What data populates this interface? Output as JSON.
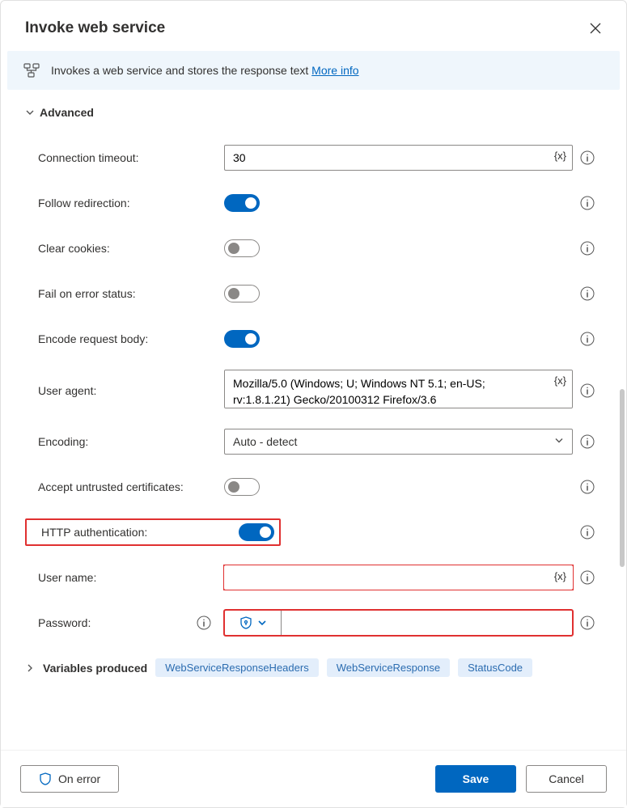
{
  "header": {
    "title": "Invoke web service"
  },
  "banner": {
    "text": "Invokes a web service and stores the response text",
    "moreLabel": "More info"
  },
  "sections": {
    "advanced": "Advanced",
    "variablesProduced": "Variables produced"
  },
  "fields": {
    "connectionTimeout": {
      "label": "Connection timeout:",
      "value": "30"
    },
    "followRedirection": {
      "label": "Follow redirection:",
      "on": true
    },
    "clearCookies": {
      "label": "Clear cookies:",
      "on": false
    },
    "failOnError": {
      "label": "Fail on error status:",
      "on": false
    },
    "encodeBody": {
      "label": "Encode request body:",
      "on": true
    },
    "userAgent": {
      "label": "User agent:",
      "value": "Mozilla/5.0 (Windows; U; Windows NT 5.1; en-US; rv:1.8.1.21) Gecko/20100312 Firefox/3.6"
    },
    "encoding": {
      "label": "Encoding:",
      "value": "Auto - detect"
    },
    "acceptUntrusted": {
      "label": "Accept untrusted certificates:",
      "on": false
    },
    "httpAuth": {
      "label": "HTTP authentication:",
      "on": true
    },
    "userName": {
      "label": "User name:",
      "value": ""
    },
    "password": {
      "label": "Password:",
      "value": ""
    }
  },
  "varToken": "{x}",
  "variables": [
    "WebServiceResponseHeaders",
    "WebServiceResponse",
    "StatusCode"
  ],
  "footer": {
    "onError": "On error",
    "save": "Save",
    "cancel": "Cancel"
  }
}
